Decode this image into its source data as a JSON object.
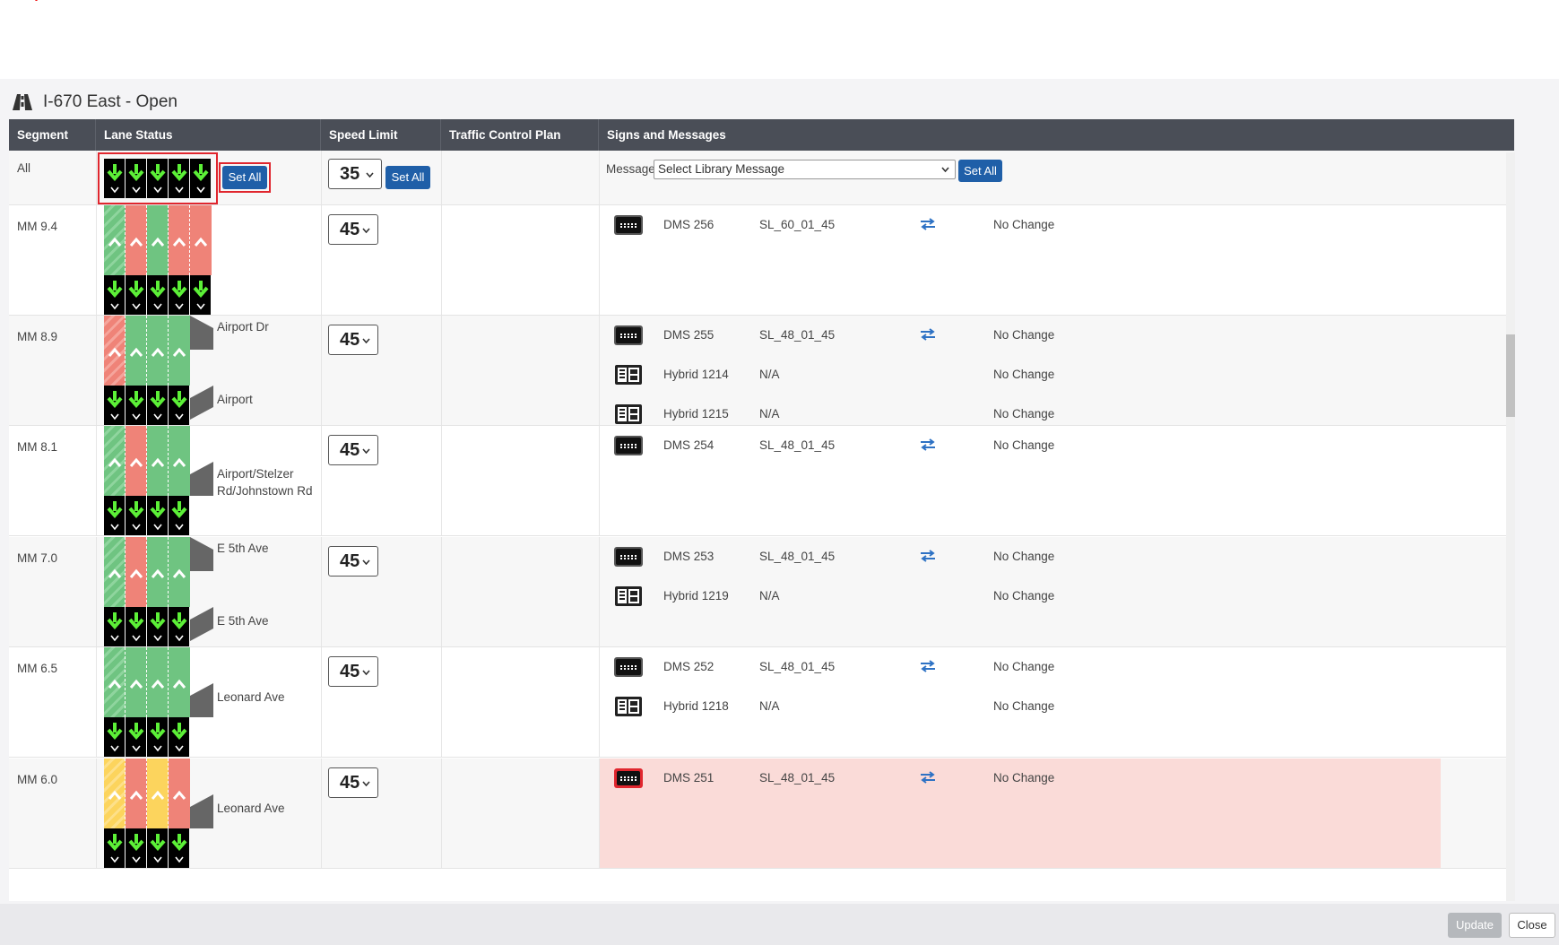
{
  "title": "I-670 East - Open",
  "columns": [
    "Segment",
    "Lane Status",
    "Speed Limit",
    "Traffic Control Plan",
    "Signs and Messages"
  ],
  "all_row": {
    "segment": "All",
    "set_all_lanes": "Set All",
    "speed": "35",
    "set_all_speed": "Set All",
    "message_label": "Message",
    "message_select": "Select Library Message",
    "set_all_message": "Set All"
  },
  "rows": [
    {
      "segment": "MM 9.4",
      "lanes": [
        "hatch-g",
        "red",
        "green",
        "red",
        "red"
      ],
      "speed": "45",
      "ramps": [],
      "signs": [
        {
          "icon": "dms-icon",
          "name": "DMS 256",
          "message": "SL_60_01_45",
          "swap": true,
          "status": "No Change"
        }
      ]
    },
    {
      "segment": "MM 8.9",
      "lanes": [
        "hatch-r",
        "green",
        "green",
        "green"
      ],
      "speed": "45",
      "ramps": [
        "Airport Dr",
        "Airport"
      ],
      "signs": [
        {
          "icon": "dms-icon",
          "name": "DMS 255",
          "message": "SL_48_01_45",
          "swap": true,
          "status": "No Change"
        },
        {
          "icon": "hybrid-sign-icon",
          "name": "Hybrid 1214",
          "message": "N/A",
          "swap": false,
          "status": "No Change"
        },
        {
          "icon": "hybrid-sign-icon",
          "name": "Hybrid 1215",
          "message": "N/A",
          "swap": false,
          "status": "No Change"
        }
      ]
    },
    {
      "segment": "MM 8.1",
      "lanes": [
        "hatch-g",
        "red",
        "green",
        "green"
      ],
      "speed": "45",
      "ramps": [
        "Airport/Stelzer Rd/Johnstown Rd"
      ],
      "signs": [
        {
          "icon": "dms-icon",
          "name": "DMS 254",
          "message": "SL_48_01_45",
          "swap": true,
          "status": "No Change"
        }
      ]
    },
    {
      "segment": "MM 7.0",
      "lanes": [
        "hatch-g",
        "red",
        "green",
        "green"
      ],
      "speed": "45",
      "ramps": [
        "E 5th Ave",
        "E 5th Ave"
      ],
      "signs": [
        {
          "icon": "dms-icon",
          "name": "DMS 253",
          "message": "SL_48_01_45",
          "swap": true,
          "status": "No Change"
        },
        {
          "icon": "hybrid-sign-icon",
          "name": "Hybrid 1219",
          "message": "N/A",
          "swap": false,
          "status": "No Change"
        }
      ]
    },
    {
      "segment": "MM 6.5",
      "lanes": [
        "hatch-g",
        "green",
        "green",
        "green"
      ],
      "speed": "45",
      "ramps": [
        "Leonard Ave"
      ],
      "signs": [
        {
          "icon": "dms-icon",
          "name": "DMS 252",
          "message": "SL_48_01_45",
          "swap": true,
          "status": "No Change"
        },
        {
          "icon": "hybrid-sign-icon",
          "name": "Hybrid 1218",
          "message": "N/A",
          "swap": false,
          "status": "No Change"
        }
      ]
    },
    {
      "segment": "MM 6.0",
      "lanes": [
        "hatch-y",
        "red",
        "yellow",
        "red"
      ],
      "speed": "45",
      "ramps": [
        "Leonard Ave"
      ],
      "signs": [
        {
          "icon": "dms-alert-icon",
          "name": "DMS 251",
          "message": "SL_48_01_45",
          "swap": true,
          "status": "No Change"
        }
      ]
    }
  ],
  "footer": {
    "update": "Update",
    "close": "Close"
  },
  "colors": {
    "header_bg": "#4a4e57",
    "lane_green": "#6fc481",
    "lane_red": "#ef8378",
    "lane_yellow": "#fcd45d",
    "button_blue": "#1f5fa8",
    "highlight_red": "#e0262e",
    "alert_row": "#fadbd8"
  }
}
